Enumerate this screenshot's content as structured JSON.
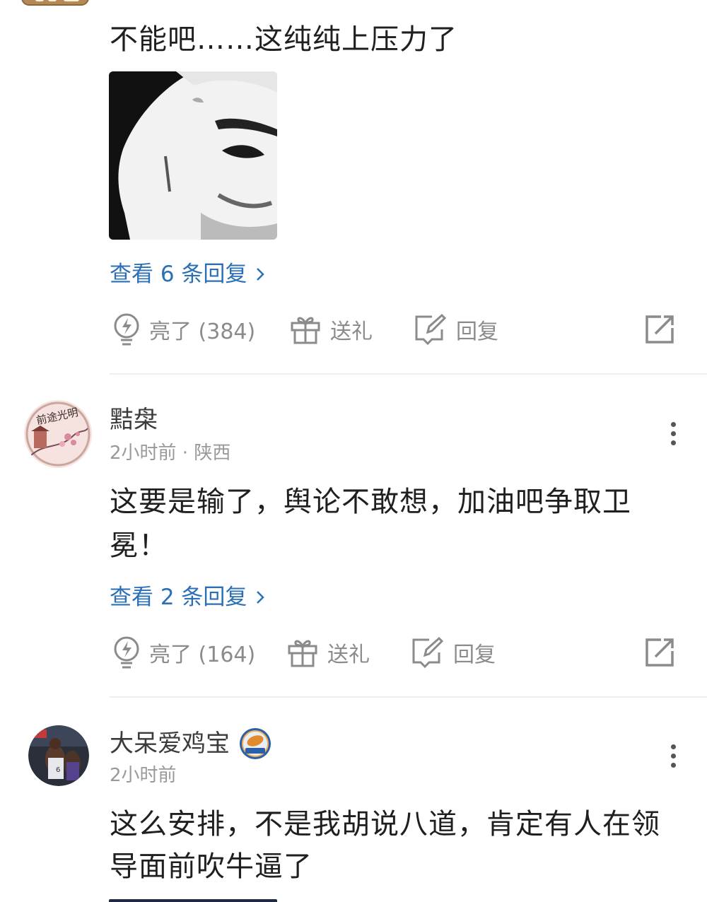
{
  "comments": [
    {
      "text": "不能吧……这纯纯上压力了",
      "meme_icon": "shocked-face-meme",
      "view_replies": "查看 6 条回复",
      "like": "亮了 (384)",
      "gift": "送礼",
      "reply": "回复"
    },
    {
      "username": "黠㭧",
      "avatar_text": "前途光明",
      "meta": "2小时前 · 陕西",
      "text_line1": "这要是输了，舆论不敢想，加油吧争取卫",
      "text_line2": "冕！",
      "view_replies": "查看 2 条回复",
      "like": "亮了 (164)",
      "gift": "送礼",
      "reply": "回复"
    },
    {
      "username": "大呆爱鸡宝",
      "meta": "2小时前",
      "text_line1": "这么安排，不是我胡说八道，肯定有人在领",
      "text_line2": "导面前吹牛逼了"
    }
  ],
  "icons": {
    "like": "lightbulb-icon",
    "gift": "gift-icon",
    "reply": "edit-reply-icon",
    "share": "share-icon",
    "more": "more-vertical-icon",
    "chevron": "chevron-right-icon",
    "level_badge": "level-badge-icon"
  },
  "colors": {
    "link": "#2b6fb6",
    "muted": "#8b8b8b",
    "text": "#1f1f1f"
  }
}
